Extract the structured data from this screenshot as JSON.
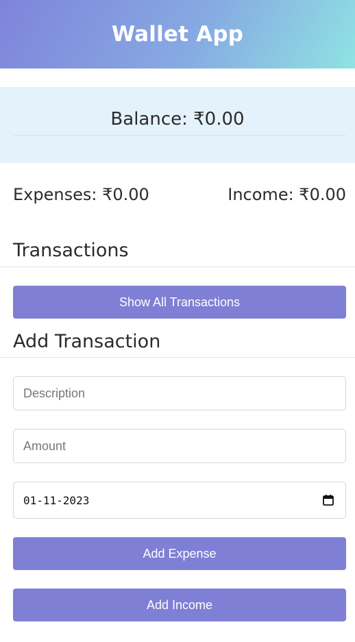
{
  "header": {
    "title": "Wallet App"
  },
  "balance": {
    "text": "Balance: ₹0.00"
  },
  "summary": {
    "expenses": "Expenses: ₹0.00",
    "income": "Income: ₹0.00"
  },
  "transactions": {
    "heading": "Transactions",
    "show_all_label": "Show All Transactions"
  },
  "add_transaction": {
    "heading": "Add Transaction",
    "description_placeholder": "Description",
    "description_value": "",
    "amount_placeholder": "Amount",
    "amount_value": "",
    "date_value": "01-11-2023",
    "date_icon": "calendar-icon",
    "add_expense_label": "Add Expense",
    "add_income_label": "Add Income"
  },
  "colors": {
    "header_gradient_start": "#7f83db",
    "header_gradient_end": "#8fe3e3",
    "button": "#7f7fd5",
    "balance_panel": "#e4f2fb"
  }
}
